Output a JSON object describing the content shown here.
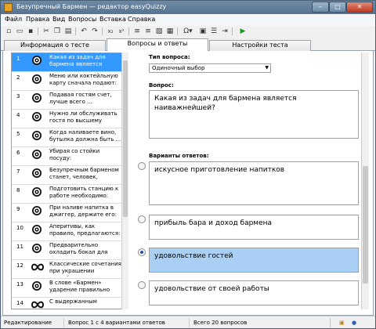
{
  "window": {
    "title": "Безупречный Бармен — редактор easyQuizzy"
  },
  "menu": [
    "Файл",
    "Правка",
    "Вид",
    "Вопросы",
    "Вставка",
    "Справка"
  ],
  "toolbar": {
    "omega": "Ω"
  },
  "tabs": [
    "Информация о тесте",
    "Вопросы и ответы",
    "Настройки теста"
  ],
  "questions": [
    {
      "num": "1",
      "icon": "target",
      "text": "Какая из задач для бармена является наива..."
    },
    {
      "num": "2",
      "icon": "target",
      "text": "Меню или коктейльную карту сначала подают:"
    },
    {
      "num": "3",
      "icon": "target",
      "text": "Подавая гостям счет, лучше всего ..."
    },
    {
      "num": "4",
      "icon": "target",
      "text": "Нужно ли обслуживать гостя по высшему класс..."
    },
    {
      "num": "5",
      "icon": "target",
      "text": "Когда наливаете вино, бутылка должна быть ..."
    },
    {
      "num": "6",
      "icon": "target",
      "text": "Убирая со стойки посуду:"
    },
    {
      "num": "7",
      "icon": "target",
      "text": "Безупречным барменом станет, человек, которы..."
    },
    {
      "num": "8",
      "icon": "target",
      "text": "Подготовить станцию к работе необходимо:"
    },
    {
      "num": "9",
      "icon": "target",
      "text": "При наливе напитка в джиггер, держите его:"
    },
    {
      "num": "10",
      "icon": "target",
      "text": "Аперитивы, как правило, предлагаются:"
    },
    {
      "num": "11",
      "icon": "target",
      "text": "Предварительно охладить бокал для подачи напит..."
    },
    {
      "num": "12",
      "icon": "infinity",
      "text": "Классические сочетания при украшении коктейл..."
    },
    {
      "num": "13",
      "icon": "target",
      "text": "В слове «Бармен» ударение правильно ста..."
    },
    {
      "num": "14",
      "icon": "infinity",
      "text": "С выдержанным"
    }
  ],
  "editor": {
    "type_label": "Тип вопроса:",
    "type_value": "Одиночный выбор",
    "question_label": "Вопрос:",
    "question_text": "Какая из задач для бармена является наиважнейшей?",
    "answers_label": "Варианты ответов:",
    "answers": [
      {
        "text": "искусное приготовление напитков",
        "checked": false
      },
      {
        "text": "прибыль бара и доход бармена",
        "checked": false
      },
      {
        "text": "удовольствие гостей",
        "checked": true
      },
      {
        "text": "удовольствие от своей работы",
        "checked": false
      }
    ]
  },
  "status": {
    "mode": "Редактирование",
    "question_info": "Вопрос 1 с 4 вариантами ответов",
    "total": "Всего 20 вопросов"
  },
  "colors": {
    "selection": "#3399ff",
    "selected_answer": "#a9cff5",
    "titlebar": "#56738f"
  }
}
